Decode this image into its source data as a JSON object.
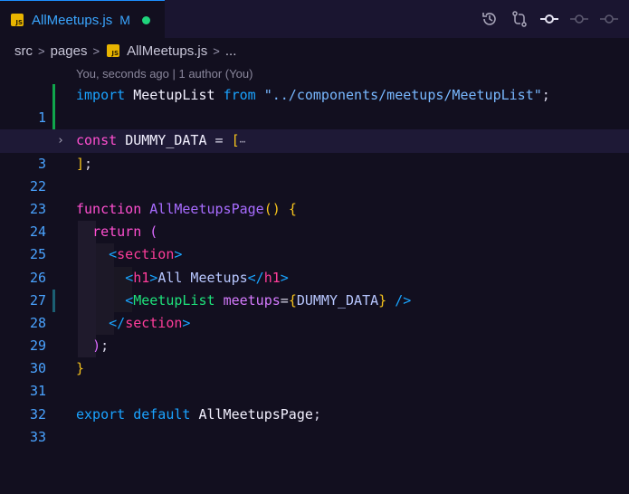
{
  "tab": {
    "filename": "AllMeetups.js",
    "modified_marker": "M",
    "file_icon_text": "JS"
  },
  "toolbar": {
    "icons": [
      "history-icon",
      "compare-changes-icon",
      "git-commit-icon",
      "previous-change-icon",
      "next-change-icon"
    ]
  },
  "breadcrumb": {
    "segments": [
      "src",
      "pages",
      "AllMeetups.js",
      "..."
    ],
    "separator": ">"
  },
  "blame": "You, seconds ago | 1 author (You)",
  "lines": [
    {
      "num": "1",
      "tokens": [
        "import",
        " ",
        "MeetupList",
        " ",
        "from",
        " ",
        "\"../components/meetups/MeetupList\"",
        ";"
      ]
    },
    {
      "num": "2",
      "tokens": []
    },
    {
      "num": "3",
      "tokens": [
        "const",
        " ",
        "DUMMY_DATA",
        " = ",
        "[",
        "⋯"
      ]
    },
    {
      "num": "22",
      "tokens": [
        "]",
        ";"
      ]
    },
    {
      "num": "23",
      "tokens": []
    },
    {
      "num": "24",
      "tokens": [
        "function",
        " ",
        "AllMeetupsPage",
        "()",
        " ",
        "{"
      ]
    },
    {
      "num": "25",
      "tokens": [
        "  ",
        "return",
        " ",
        "("
      ]
    },
    {
      "num": "26",
      "tokens": [
        "    ",
        "<",
        "section",
        ">"
      ]
    },
    {
      "num": "27",
      "tokens": [
        "      ",
        "<",
        "h1",
        ">",
        "All Meetups",
        "</",
        "h1",
        ">"
      ]
    },
    {
      "num": "28",
      "tokens": [
        "      ",
        "<",
        "MeetupList",
        " ",
        "meetups",
        "=",
        "{",
        "DUMMY_DATA",
        "}",
        " ",
        "/>"
      ]
    },
    {
      "num": "29",
      "tokens": [
        "    ",
        "</",
        "section",
        ">"
      ]
    },
    {
      "num": "30",
      "tokens": [
        "  ",
        ")",
        ";"
      ]
    },
    {
      "num": "31",
      "tokens": [
        "}"
      ]
    },
    {
      "num": "32",
      "tokens": []
    },
    {
      "num": "33",
      "tokens": [
        "export",
        " ",
        "default",
        " ",
        "AllMeetupsPage",
        ";"
      ]
    }
  ],
  "colors": {
    "background": "#120f1f",
    "keyword": "#1aa3ff",
    "const_keyword": "#ff4fd0",
    "string": "#78b8ff",
    "bracket": "#f6c31c",
    "function_name": "#a86cff",
    "component": "#1ee37c",
    "git_added": "#10a64c",
    "modified_dot": "#1fd47c"
  }
}
